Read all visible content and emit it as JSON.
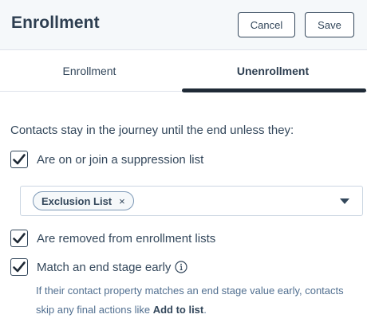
{
  "header": {
    "title": "Enrollment",
    "cancel_label": "Cancel",
    "save_label": "Save"
  },
  "tabs": [
    {
      "label": "Enrollment",
      "active": false
    },
    {
      "label": "Unenrollment",
      "active": true
    }
  ],
  "intro_text": "Contacts stay in the journey until the end unless they:",
  "conditions": [
    {
      "label": "Are on or join a suppression list",
      "checked": true
    },
    {
      "label": "Are removed from enrollment lists",
      "checked": true
    },
    {
      "label": "Match an end stage early",
      "checked": true
    }
  ],
  "suppression_select": {
    "selected_tags": [
      "Exclusion List"
    ],
    "remove_glyph": "×"
  },
  "helper": {
    "text_before": "If their contact property matches an end stage value early, contacts skip any final actions like ",
    "bold_text": "Add to list",
    "text_after": "."
  },
  "icons": {
    "checkbox_checked": "check-icon",
    "dropdown": "caret-down-icon",
    "info": "info-icon"
  },
  "colors": {
    "text": "#33475b",
    "heading": "#2d3e50",
    "header_bg": "#f5f8fa",
    "tab_underline": "#1f2a36",
    "border": "#cbd6e2"
  }
}
